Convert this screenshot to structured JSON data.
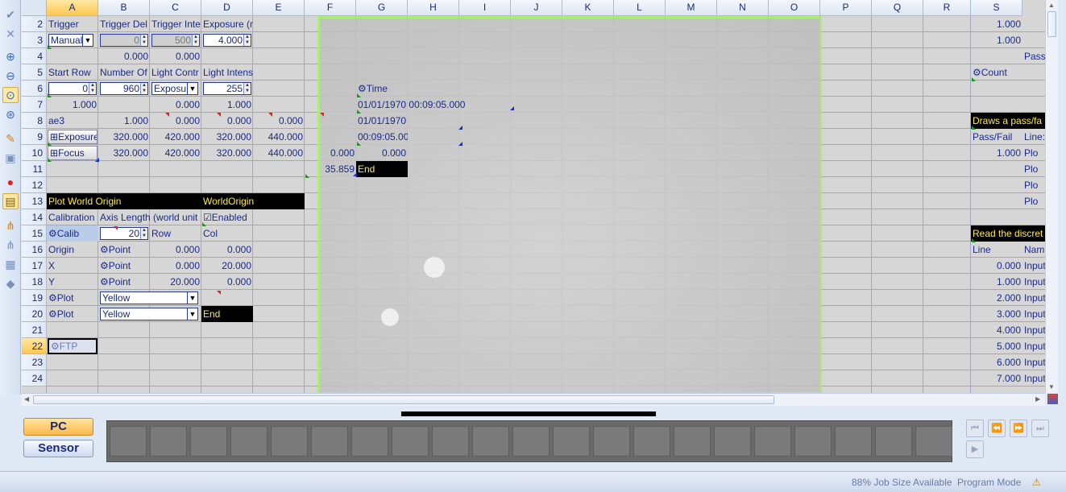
{
  "columns": [
    "A",
    "B",
    "C",
    "D",
    "E",
    "F",
    "G",
    "H",
    "I",
    "J",
    "K",
    "L",
    "M",
    "N",
    "O",
    "P",
    "Q",
    "R",
    "S"
  ],
  "rows": [
    "2",
    "3",
    "4",
    "5",
    "6",
    "7",
    "8",
    "9",
    "10",
    "11",
    "12",
    "13",
    "14",
    "15",
    "16",
    "17",
    "18",
    "19",
    "20",
    "21",
    "22",
    "23",
    "24"
  ],
  "cells": {
    "A2": "Trigger",
    "B2": "Trigger Del",
    "C2": "Trigger Inte",
    "D2": "Exposure (msec)",
    "A3": "Manual",
    "B3": "0",
    "C3": "500",
    "D3": "4.000",
    "B4": "0.000",
    "C4": "0.000",
    "A5": "Start Row",
    "B5": "Number Of",
    "C5": "Light Contr",
    "D5": "Light Intensity",
    "A6": "0",
    "B6": "960",
    "C6": "Exposu",
    "D6": "255",
    "A7": "1.000",
    "C7": "0.000",
    "D7": "1.000",
    "A8": "ae3",
    "B8": "1.000",
    "C8": "0.000",
    "D8": "0.000",
    "E8": "0.000",
    "A9": "Exposure",
    "B9": "320.000",
    "C9": "420.000",
    "D9": "320.000",
    "E9": "440.000",
    "A10": "Focus",
    "B10": "320.000",
    "C10": "420.000",
    "D10": "320.000",
    "E10": "440.000",
    "F10": "0.000",
    "G10": "0.000",
    "F11": "35.859",
    "G11": "End",
    "A13": "Plot World Origin",
    "D13": "WorldOrigin",
    "A14": "Calibration",
    "B14": "Axis Length (world unit",
    "D14": "Enabled",
    "A15": "Calib",
    "B15": "20",
    "C15": "Row",
    "D15": "Col",
    "A16": "Origin",
    "B16": "Point",
    "C16": "0.000",
    "D16": "0.000",
    "A17": "X",
    "B17": "Point",
    "C17": "0.000",
    "D17": "20.000",
    "A18": "Y",
    "B18": "Point",
    "C18": "20.000",
    "D18": "0.000",
    "A19": "Plot",
    "B19": "Yellow",
    "A20": "Plot",
    "B20": "Yellow",
    "D20": "End",
    "A22": "FTP",
    "G6": "Time",
    "G7": "01/01/1970 00:09:05.000",
    "G8": "01/01/1970",
    "G9": "00:09:05.000",
    "S2": "1.000",
    "S3": "1.000",
    "T4": "Pass",
    "S5": "Count",
    "S8": "Draws a pass/fa",
    "S9": "Pass/Fail",
    "T9": "Line:",
    "S10": "1.000",
    "T10": "Plo",
    "T11": "Plo",
    "T12": "Plo",
    "T13": "Plo",
    "S15": "Read the discret",
    "S16": "Line",
    "T16": "Nam",
    "S17": "0.000",
    "T17": "Input",
    "S18": "1.000",
    "T18": "Input",
    "S19": "2.000",
    "T19": "Input",
    "S20": "3.000",
    "T20": "Input",
    "S21": "4.000",
    "T21": "Input",
    "S22": "5.000",
    "T22": "Input",
    "S23": "6.000",
    "T23": "Input",
    "S24": "7.000",
    "T24": "Input"
  },
  "mode_buttons": {
    "pc": "PC",
    "sensor": "Sensor"
  },
  "status": {
    "job_size": "88% Job Size Available",
    "mode": "Program Mode"
  },
  "colors": {
    "selected_header": "#fcc94f",
    "image_border": "#a6f06a",
    "black_label_text": "#ffe94a"
  },
  "icons": [
    "check-icon",
    "close-icon",
    "zoom-in-icon",
    "zoom-out-icon",
    "zoom-fit-icon",
    "zoom-region-icon",
    "live-icon",
    "capture-icon",
    "record-icon",
    "spreadsheet-icon",
    "tree-icon",
    "tree2-icon",
    "disabled-icon",
    "warning-icon"
  ]
}
